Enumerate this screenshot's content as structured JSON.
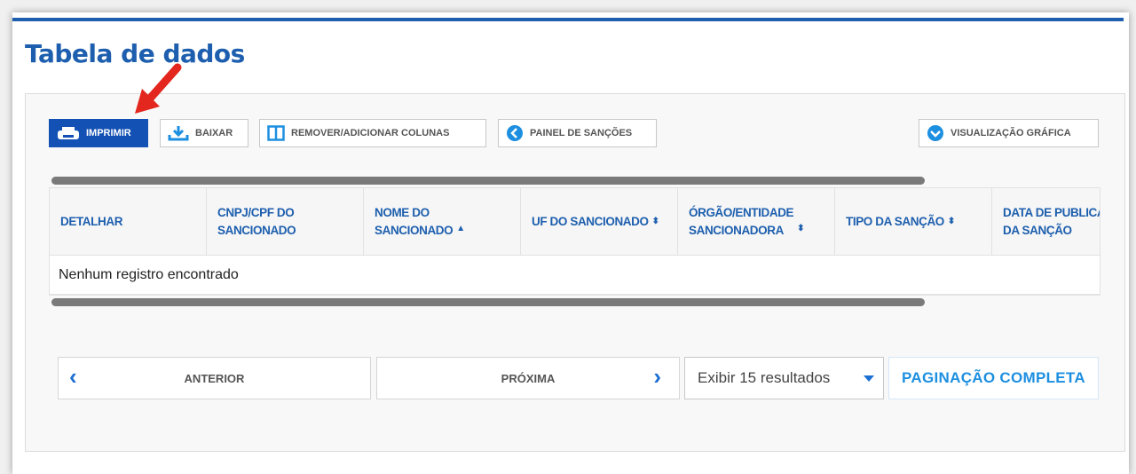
{
  "page_title": "Tabela de dados",
  "toolbar": {
    "print_label": "IMPRIMIR",
    "download_label": "BAIXAR",
    "columns_label": "REMOVER/ADICIONAR COLUNAS",
    "panel_label": "PAINEL DE SANÇÕES",
    "chart_view_label": "VISUALIZAÇÃO GRÁFICA"
  },
  "table": {
    "columns": [
      {
        "label": "DETALHAR",
        "sort": ""
      },
      {
        "label": "CNPJ/CPF DO\nSANCIONADO",
        "sort": ""
      },
      {
        "label": "NOME DO\nSANCIONADO",
        "sort": "▲"
      },
      {
        "label": "UF DO SANCIONADO",
        "sort": "⬍"
      },
      {
        "label": "ÓRGÃO/ENTIDADE\nSANCIONADORA",
        "sort": "⬍"
      },
      {
        "label": "TIPO DA SANÇÃO",
        "sort": "⬍"
      },
      {
        "label": "DATA DE PUBLICAÇÃO\nDA SANÇÃO",
        "sort": "⬍"
      }
    ],
    "empty_message": "Nenhum registro encontrado"
  },
  "pagination": {
    "previous_label": "ANTERIOR",
    "next_label": "PRÓXIMA",
    "page_size_selected": "Exibir 15 resultados",
    "full_pagination_label": "PAGINAÇÃO COMPLETA"
  },
  "colors": {
    "primary": "#1351b4",
    "title": "#1d5fae",
    "accent_link": "#1d8fe0",
    "annotation_arrow": "#e3261e"
  },
  "icons": [
    "printer-icon",
    "download-icon",
    "columns-icon",
    "chevron-left-circle-icon",
    "chevron-down-circle-icon",
    "chevron-left-icon",
    "chevron-right-icon",
    "caret-down-icon",
    "annotation-arrow-icon"
  ]
}
